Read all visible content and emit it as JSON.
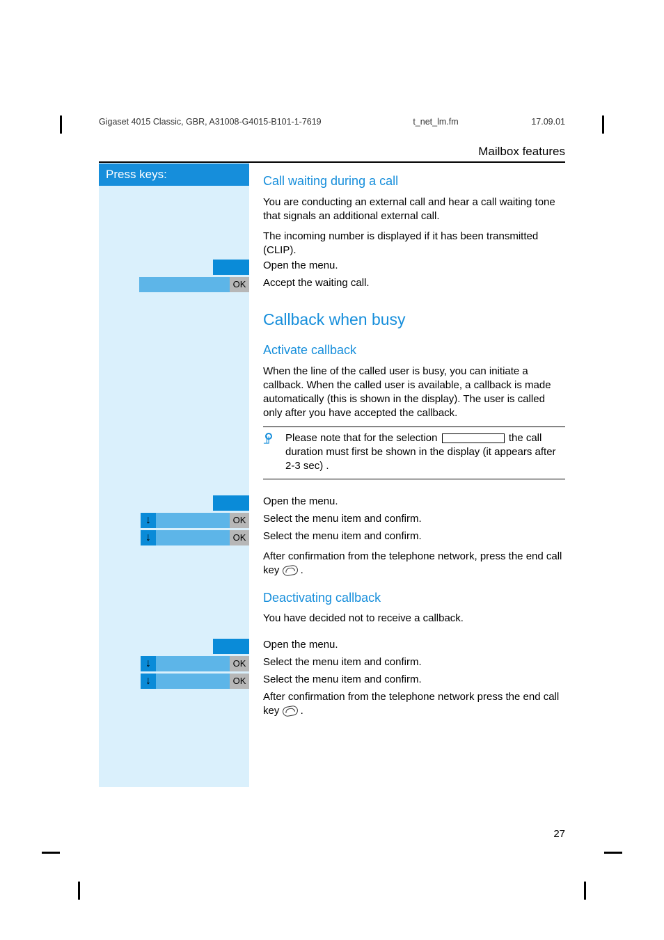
{
  "header": {
    "doc_id": "Gigaset 4015 Classic, GBR, A31008-G4015-B101-1-7619",
    "file": "t_net_lm.fm",
    "date": "17.09.01"
  },
  "section_title": "Mailbox features",
  "sidebar": {
    "title": "Press keys:",
    "ok": "OK",
    "down": "↓"
  },
  "sec1": {
    "heading": "Call waiting during a call",
    "p1": "You are conducting an external call and hear a call waiting tone that signals an additional external call.",
    "p2": "The incoming number is displayed if it has been transmitted (CLIP).",
    "step_open": "Open the menu.",
    "step_accept": "Accept the waiting call."
  },
  "sec2": {
    "heading": "Callback when busy",
    "sub1": {
      "heading": "Activate callback",
      "p1": "When the line of the called user is busy, you can initiate a callback. When the called user is available, a callback is made automatically (this is shown in the display). The user is called only after you have accepted the callback.",
      "note_a": "Please note that for the selection",
      "note_b": " the call duration must first be shown in the display (it appears after 2-3 sec) .",
      "step_open": "Open the menu.",
      "step_sel1": "Select the menu item and confirm.",
      "step_sel2": "Select the menu item and confirm.",
      "p_after": "After confirmation from the telephone network, press the end call key ",
      "p_after_tail": " ."
    },
    "sub2": {
      "heading": "Deactivating callback",
      "p1": "You have decided not to receive a callback.",
      "step_open": "Open the menu.",
      "step_sel1": "Select the menu item and confirm.",
      "step_sel2": "Select the menu item and confirm.",
      "p_after": "After confirmation from the telephone network press the end call key ",
      "p_after_tail": " ."
    }
  },
  "page_number": "27"
}
